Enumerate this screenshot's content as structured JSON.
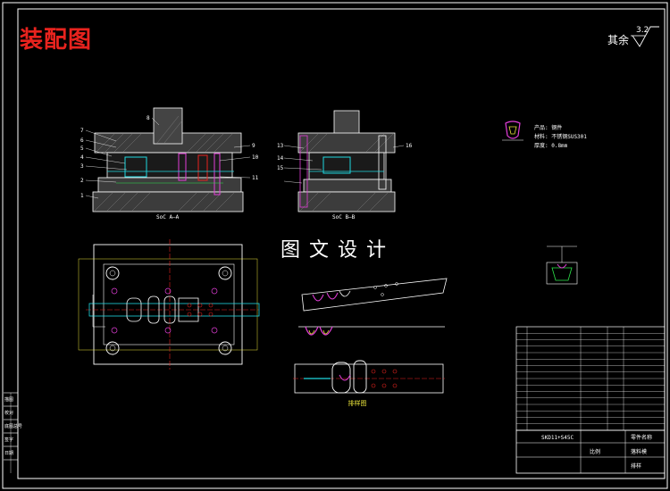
{
  "drawing": {
    "title": "装配图",
    "watermark": "图文设计",
    "roughness_label": "其余",
    "roughness_value": "3.2"
  },
  "section_labels": {
    "front_section": "SoC A—A",
    "side_section": "SoC B—B",
    "strip_layout": "排样图"
  },
  "part_notes": {
    "product": "产品: 钢件",
    "material": "材料: 不锈钢SUS301",
    "thickness": "厚度: 0.8mm"
  },
  "balloon_numbers": {
    "left_view": [
      "7",
      "6",
      "5",
      "4",
      "3",
      "2",
      "1",
      "8",
      "9",
      "10",
      "11"
    ],
    "side_view": [
      "13",
      "14",
      "15",
      "16"
    ]
  },
  "title_block": {
    "part_code": "SKD11+S45C",
    "designer_label": "零件名称",
    "drawing_name": "落料模",
    "scale_label": "比例",
    "sheet_label": "排样"
  },
  "left_strip": {
    "rows": [
      "描图",
      "校对",
      "底图总号",
      "签字",
      "日期"
    ]
  },
  "colors": {
    "line_white": "#ffffff",
    "cyan": "#1fd8e0",
    "green": "#2ee64b",
    "magenta": "#e23ed8",
    "red": "#e8231e",
    "yellow": "#e8e23a",
    "blue": "#2f6bff"
  }
}
